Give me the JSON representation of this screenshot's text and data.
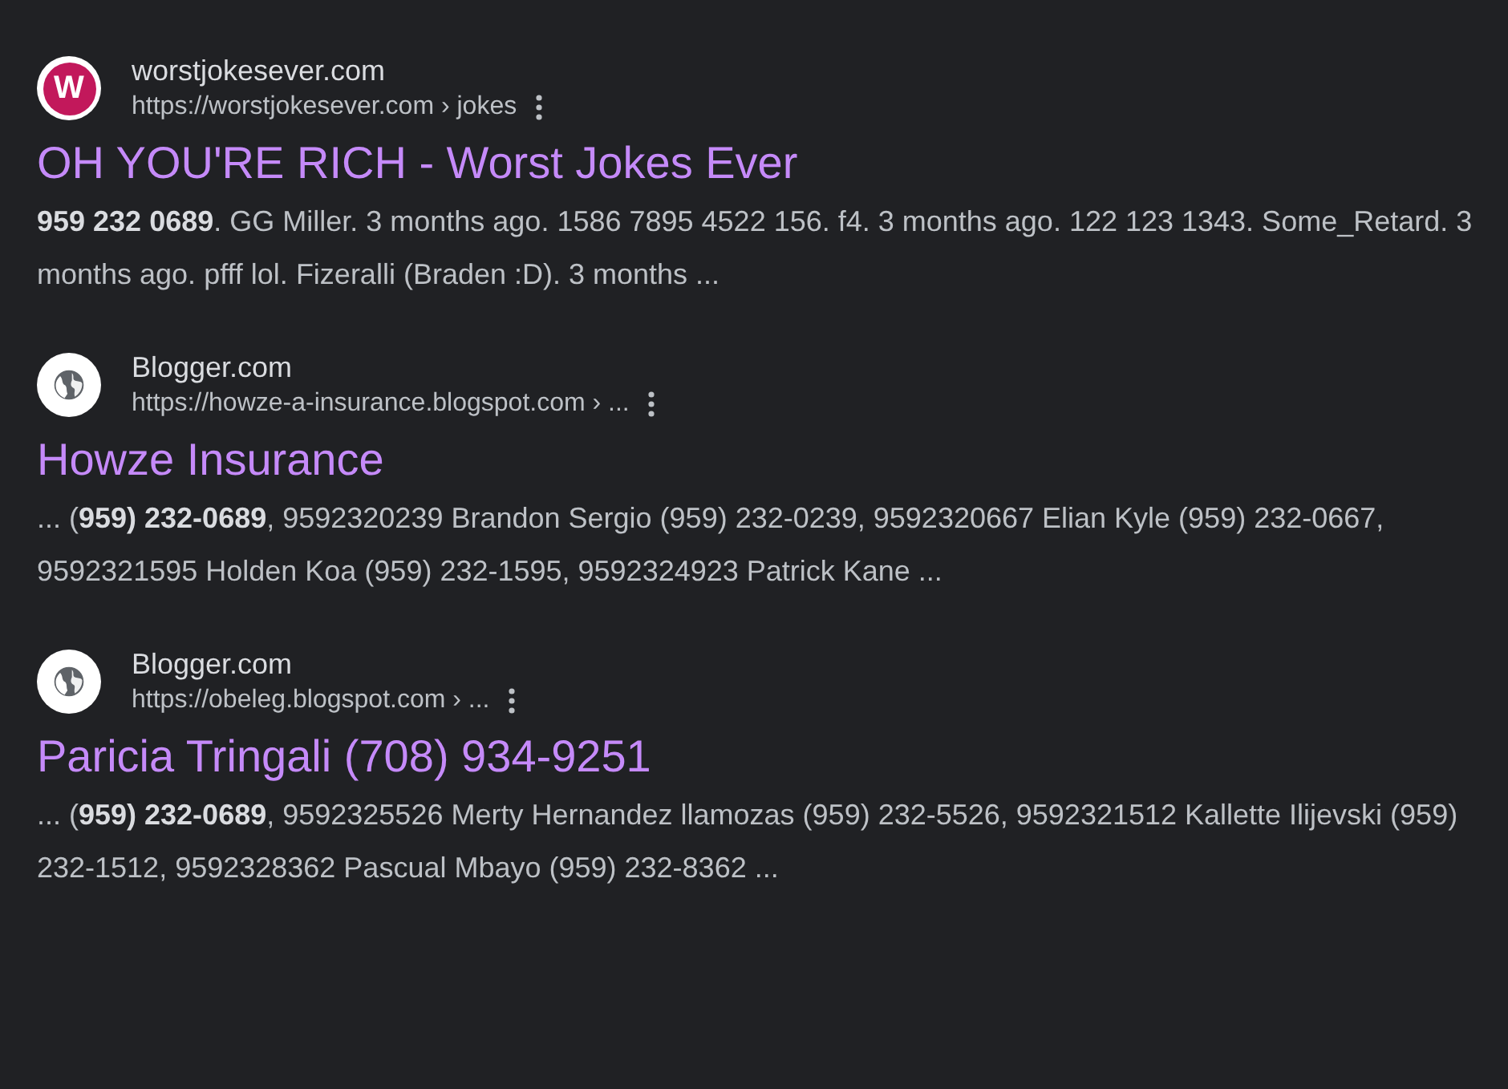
{
  "results": [
    {
      "favicon": {
        "kind": "letter",
        "letter": "W"
      },
      "site": "worstjokesever.com",
      "url": "https://worstjokesever.com › jokes",
      "title": "OH YOU'RE RICH - Worst Jokes Ever",
      "snippet": "**959 232 0689**. GG Miller. 3 months ago. 1586 7895 4522 156. f4. 3 months ago. 122 123 1343. Some_Retard. 3 months ago. pfff lol. Fizeralli (Braden :D). 3 months ..."
    },
    {
      "favicon": {
        "kind": "globe"
      },
      "site": "Blogger.com",
      "url": "https://howze-a-insurance.blogspot.com › ...",
      "title": "Howze Insurance",
      "snippet": "... (**959) 232-0689**, 9592320239 Brandon Sergio (959) 232-0239, 9592320667 Elian Kyle (959) 232-0667, 9592321595 Holden Koa (959) 232-1595, 9592324923 Patrick Kane ..."
    },
    {
      "favicon": {
        "kind": "globe"
      },
      "site": "Blogger.com",
      "url": "https://obeleg.blogspot.com › ...",
      "title": "Paricia Tringali (708) 934-9251",
      "snippet": "... (**959) 232-0689**, 9592325526 Merty Hernandez llamozas (959) 232-5526, 9592321512 Kallette Ilijevski (959) 232-1512, 9592328362 Pascual Mbayo (959) 232-8362 ..."
    }
  ]
}
